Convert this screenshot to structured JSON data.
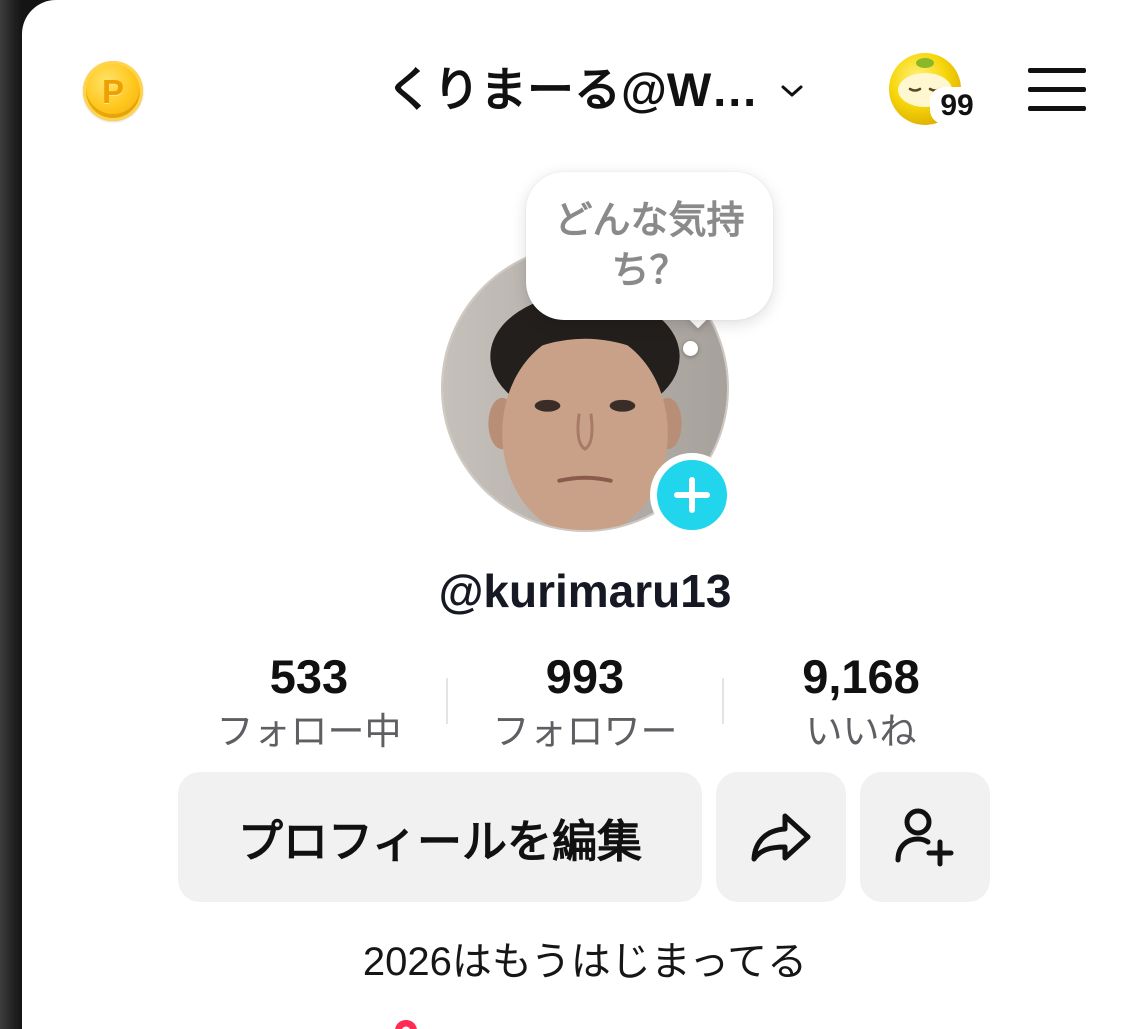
{
  "header": {
    "coin_letter": "P",
    "coin_icon": "p-coin-icon",
    "title": "くりまーる@W…",
    "chevron_icon": "chevron-down-icon",
    "avatar_icon": "yellow-face-avatar-icon",
    "avatar_badge": "99",
    "menu_icon": "hamburger-menu-icon"
  },
  "mood_bubble": {
    "lines": [
      "どんな気持",
      "ち？"
    ]
  },
  "profile": {
    "photo": "profile-photo",
    "add_icon": "plus-icon",
    "username": "@kurimaru13"
  },
  "stats": [
    {
      "value": "533",
      "label": "フォロー中"
    },
    {
      "value": "993",
      "label": "フォロワー"
    },
    {
      "value": "9,168",
      "label": "いいね"
    }
  ],
  "actions": {
    "edit_profile": "プロフィールを編集",
    "share_icon": "share-arrow-icon",
    "add_friend_icon": "add-friend-icon"
  },
  "bio": "2026はもうはじまってる",
  "bottom_peek": {
    "icon": "location-pin-icon"
  },
  "colors": {
    "accent": "#20d5ec",
    "button_bg": "#f1f1f2",
    "text": "#161823",
    "muted": "#5e5e63",
    "bubble_text": "#8a8a8a",
    "coin": "#f7b500",
    "pin": "#fe2c55"
  }
}
